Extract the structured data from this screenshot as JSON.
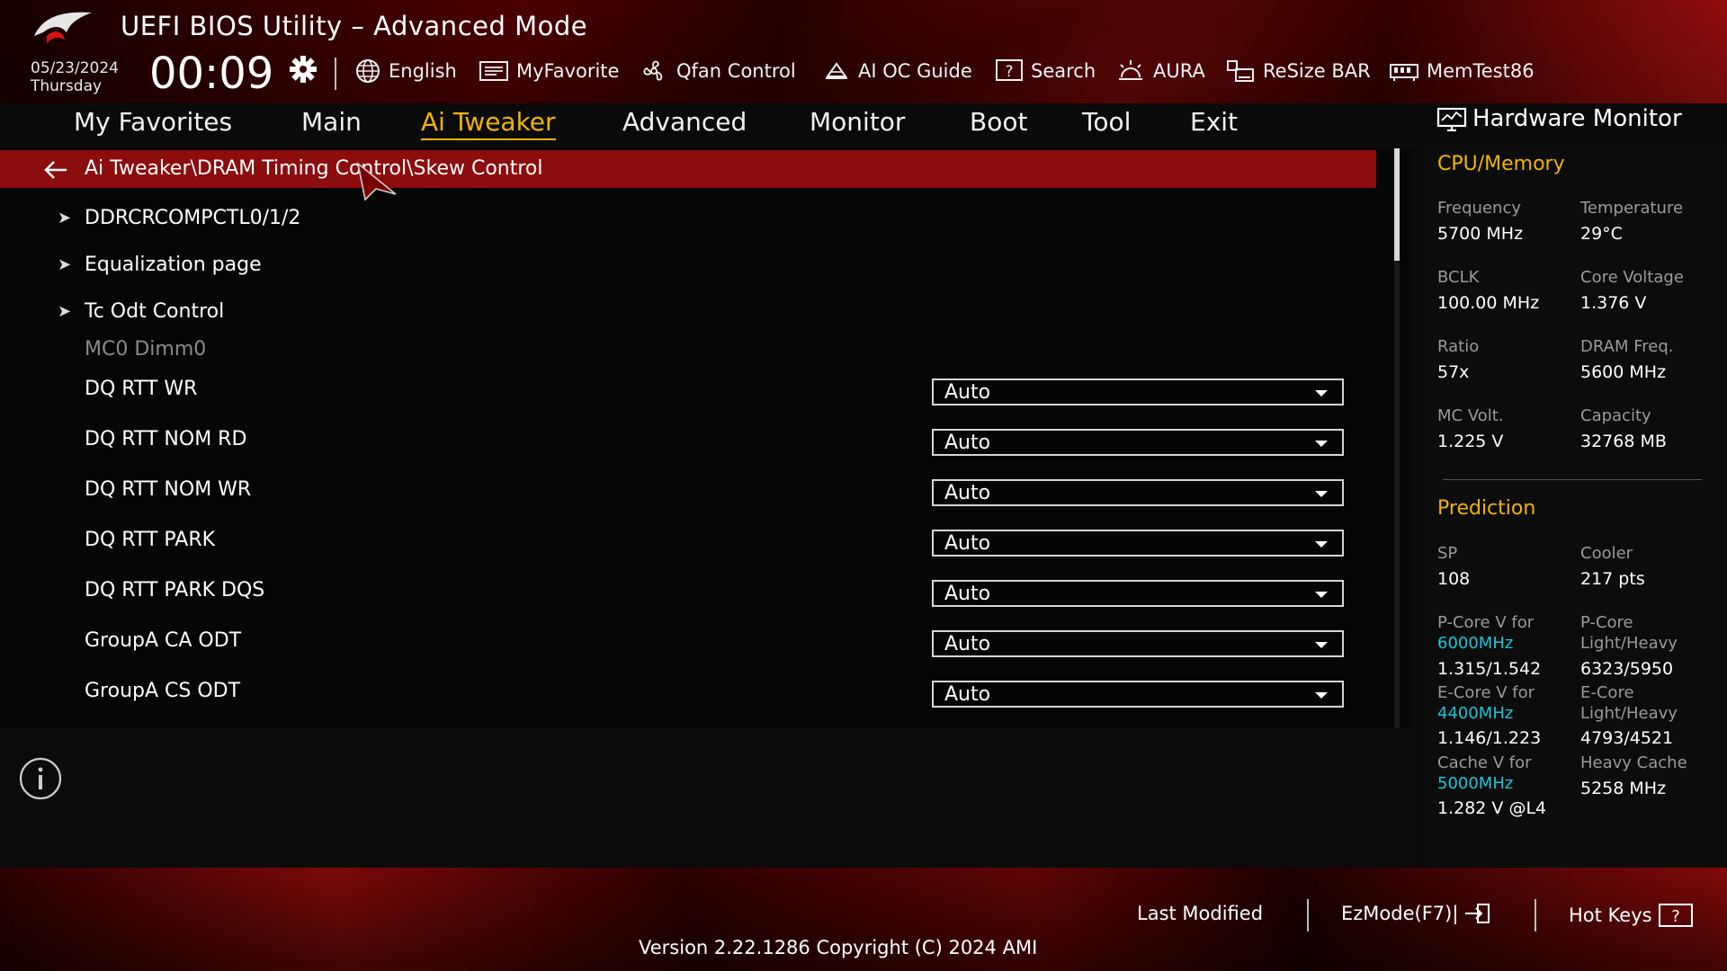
{
  "header": {
    "title": "UEFI BIOS Utility – Advanced Mode",
    "date": "05/23/2024",
    "weekday": "Thursday",
    "time": "00:09"
  },
  "toolbar": [
    {
      "label": "English",
      "icon": "globe-icon"
    },
    {
      "label": "MyFavorite",
      "icon": "favorite-icon"
    },
    {
      "label": "Qfan Control",
      "icon": "fan-icon"
    },
    {
      "label": "AI OC Guide",
      "icon": "ai-oc-guide-icon"
    },
    {
      "label": "Search",
      "icon": "help-search-icon"
    },
    {
      "label": "AURA",
      "icon": "aura-icon"
    },
    {
      "label": "ReSize BAR",
      "icon": "resize-bar-icon"
    },
    {
      "label": "MemTest86",
      "icon": "memtest-icon"
    }
  ],
  "nav": {
    "tabs": [
      "My Favorites",
      "Main",
      "Ai Tweaker",
      "Advanced",
      "Monitor",
      "Boot",
      "Tool",
      "Exit"
    ],
    "active": "Ai Tweaker"
  },
  "breadcrumb": "Ai Tweaker\\DRAM Timing Control\\Skew Control",
  "submenus": [
    "DDRCRCOMPCTL0/1/2",
    "Equalization page",
    "Tc Odt Control"
  ],
  "group_label": "MC0 Dimm0",
  "settings": [
    {
      "label": "DQ RTT WR",
      "value": "Auto"
    },
    {
      "label": "DQ RTT NOM RD",
      "value": "Auto"
    },
    {
      "label": "DQ RTT NOM WR",
      "value": "Auto"
    },
    {
      "label": "DQ RTT PARK",
      "value": "Auto"
    },
    {
      "label": "DQ RTT PARK DQS",
      "value": "Auto"
    },
    {
      "label": "GroupA CA ODT",
      "value": "Auto"
    },
    {
      "label": "GroupA CS ODT",
      "value": "Auto"
    }
  ],
  "hardware_monitor": {
    "title": "Hardware Monitor",
    "cpu_memory": {
      "section": "CPU/Memory",
      "items": [
        {
          "label": "Frequency",
          "value": "5700 MHz"
        },
        {
          "label": "Temperature",
          "value": "29°C"
        },
        {
          "label": "BCLK",
          "value": "100.00 MHz"
        },
        {
          "label": "Core Voltage",
          "value": "1.376 V"
        },
        {
          "label": "Ratio",
          "value": "57x"
        },
        {
          "label": "DRAM Freq.",
          "value": "5600 MHz"
        },
        {
          "label": "MC Volt.",
          "value": "1.225 V"
        },
        {
          "label": "Capacity",
          "value": "32768 MB"
        }
      ]
    },
    "prediction": {
      "section": "Prediction",
      "sp_label": "SP",
      "sp_value": "108",
      "cooler_label": "Cooler",
      "cooler_value": "217 pts",
      "pcore_v_label": "P-Core V for",
      "pcore_v_freq": "6000MHz",
      "pcore_v_value": "1.315/1.542",
      "pcore_lh_label1": "P-Core",
      "pcore_lh_label2": "Light/Heavy",
      "pcore_lh_value": "6323/5950",
      "ecore_v_label": "E-Core V for",
      "ecore_v_freq": "4400MHz",
      "ecore_v_value": "1.146/1.223",
      "ecore_lh_label1": "E-Core",
      "ecore_lh_label2": "Light/Heavy",
      "ecore_lh_value": "4793/4521",
      "cache_v_label": "Cache V for",
      "cache_v_freq": "5000MHz",
      "cache_v_value": "1.282 V @L4",
      "heavy_cache_label": "Heavy Cache",
      "heavy_cache_value": "5258 MHz"
    }
  },
  "footer": {
    "last_modified": "Last Modified",
    "ezmode": "EzMode(F7)|",
    "hot_keys": "Hot Keys",
    "version": "Version 2.22.1286 Copyright (C) 2024 AMI"
  },
  "colors": {
    "accent": "#f0b400",
    "breadcrumb_bg": "#8c0d0d",
    "frequency_highlight": "#18c6d6"
  }
}
